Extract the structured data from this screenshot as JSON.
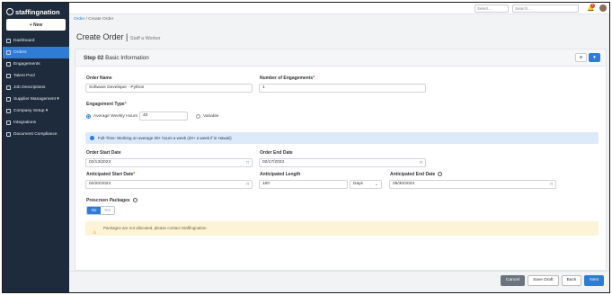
{
  "brand": {
    "name": "staffingnation"
  },
  "sidebar": {
    "new_button": "+ New",
    "items": [
      {
        "label": "Dashboard"
      },
      {
        "label": "Orders"
      },
      {
        "label": "Engagements"
      },
      {
        "label": "Talent Pool"
      },
      {
        "label": "Job Descriptions"
      },
      {
        "label": "Supplier Management ▾"
      },
      {
        "label": "Company Setup ▾"
      },
      {
        "label": "Integrations"
      },
      {
        "label": "Document Compliance"
      }
    ]
  },
  "topbar": {
    "select_placeholder": "Select...",
    "search_placeholder": "Search...",
    "notifications": "2"
  },
  "breadcrumb": {
    "root": "Order",
    "sep": "/",
    "current": "Create Order"
  },
  "page": {
    "title": "Create Order",
    "separator": "|",
    "subtitle": "Staff a Worker"
  },
  "step": {
    "number": "Step 02",
    "name": "Basic Information"
  },
  "form": {
    "order_name_label": "Order Name",
    "order_name_value": "Software Developer - Python",
    "num_engagements_label": "Number of Engagements",
    "num_engagements_value": "1",
    "engagement_type_label": "Engagement Type",
    "opt_avg": "Average Weekly Hours",
    "avg_value": "40",
    "opt_variable": "Variable",
    "info_text": "Full-Time: Working on average 30+ hours a week (20+ a week if in Hawaii)",
    "order_start_label": "Order Start Date",
    "order_start_value": "02/13/2023",
    "order_end_label": "Order End Date",
    "order_end_value": "02/17/2023",
    "ant_start_label": "Anticipated Start Date",
    "ant_start_value": "02/20/2023",
    "ant_length_label": "Anticipated Length",
    "ant_length_value": "100",
    "ant_length_unit": "Days",
    "ant_end_label": "Anticipated End Date",
    "ant_end_value": "05/30/2023",
    "prescreen_label": "Prescreen Packages",
    "toggle_no": "No",
    "toggle_yes": "Yes",
    "warn_text": "Packages are not allocated, please contact Staffingnation",
    "req": "*"
  },
  "buttons": {
    "cancel": "Cancel",
    "save": "Save Draft",
    "back": "Back",
    "next": "Next"
  },
  "colors": {
    "sidebar": "#1e2b3c",
    "accent": "#2f7bd6",
    "info_bg": "#dbe9f8",
    "warn_bg": "#fdf3d6"
  }
}
